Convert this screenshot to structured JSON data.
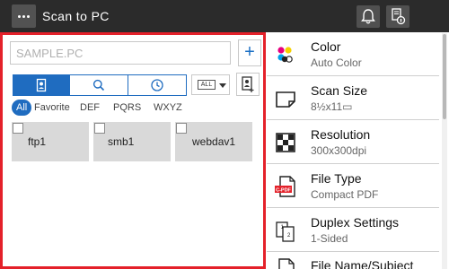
{
  "header": {
    "title": "Scan to PC",
    "menu_icon": "more-dots-icon",
    "notification_icon": "bell-icon",
    "job_icon": "job-status-icon"
  },
  "destination": {
    "input_placeholder": "SAMPLE.PC",
    "add_label": "+",
    "tabs": [
      {
        "name": "address-book",
        "icon": "address-book-icon",
        "selected": true
      },
      {
        "name": "search",
        "icon": "search-icon",
        "selected": false
      },
      {
        "name": "history",
        "icon": "clock-icon",
        "selected": false
      }
    ],
    "type_dropdown": {
      "value": "ALL"
    },
    "filters": [
      "All",
      "Favorite",
      "DEF",
      "PQRS",
      "WXYZ"
    ],
    "active_filter": "All",
    "items": [
      {
        "name": "ftp1",
        "checked": false
      },
      {
        "name": "smb1",
        "checked": false
      },
      {
        "name": "webdav1",
        "checked": false
      }
    ]
  },
  "settings": [
    {
      "label": "Color",
      "value": "Auto Color",
      "icon": "color-dots-icon"
    },
    {
      "label": "Scan Size",
      "value": "8½x11▭",
      "icon": "page-size-icon"
    },
    {
      "label": "Resolution",
      "value": "300x300dpi",
      "icon": "resolution-checker-icon"
    },
    {
      "label": "File Type",
      "value": "Compact PDF",
      "icon": "compact-pdf-icon",
      "badge": "C-PDF"
    },
    {
      "label": "Duplex Settings",
      "value": "1-Sided",
      "icon": "duplex-icon"
    },
    {
      "label": "File Name/Subject",
      "value": "",
      "icon": "file-name-icon"
    }
  ],
  "colors": {
    "accent": "#1f6cc0",
    "highlight_border": "#e4212a",
    "topbar": "#2b2b2b",
    "tile": "#d9d9d9"
  }
}
